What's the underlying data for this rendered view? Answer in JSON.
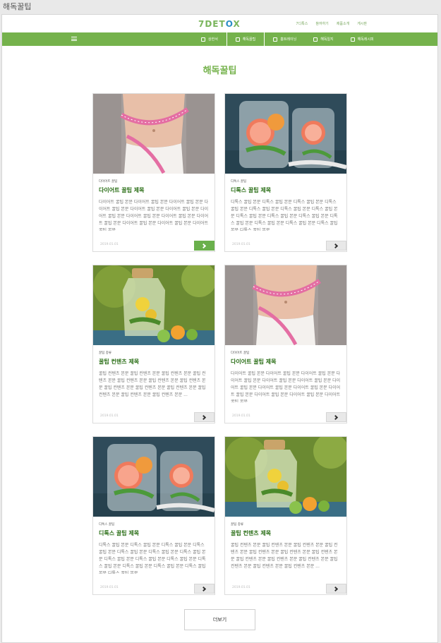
{
  "window": {
    "title": "해독꿀팁"
  },
  "header": {
    "logo": "7DETOX",
    "top_links": [
      "7디톡스",
      "참여하기",
      "제품소개",
      "게시판"
    ]
  },
  "nav": {
    "items": [
      "상한서",
      "해독꿀팁",
      "홈트레이닝",
      "해독일지",
      "해독레시피"
    ]
  },
  "section": {
    "title": "해독꿀팁"
  },
  "cards": [
    {
      "category": "다이어트 꿀팁",
      "title": "다이어트 꿀팁 제목",
      "body": "다이어트 꿀팁 본문 다이어트 꿀팁 본문 다이어트 꿀팁 본문 다이어트 꿀팁 본문 다이어트 꿀팁 본문 다이어트 꿀팁 본문 다이어트 꿀팁 본문 다이어트 꿀팁 본문 다이어트 꿀팁 본문 다이어트 꿀팁 본문 다이어트 꿀팁 본문 다이어트 꿀팁 본문 다이어트 꿀팁 본문 ...",
      "date": "2019.01.01",
      "image": "belly"
    },
    {
      "category": "디톡스 꿀팁",
      "title": "디톡스 꿀팁 제목",
      "body": "디톡스 꿀팁 본문 디톡스 꿀팁 본문 디톡스 꿀팁 본문 디톡스 꿀팁 본문 디톡스 꿀팁 본문 디톡스 꿀팁 본문 디톡스 꿀팁 본문 디톡스 꿀팁 본문 디톡스 꿀팁 본문 디톡스 꿀팁 본문 디톡스 꿀팁 본문 디톡스 꿀팁 본문 디톡스 꿀팁 본문 디톡스 꿀팁 본문 디톡스 꿀팁 본문 ...",
      "date": "2019.01.01",
      "image": "grapefruit"
    },
    {
      "category": "꿀팁 종류",
      "title": "꿀팁 컨텐츠 제목",
      "body": "꿀팁 컨텐츠 본문 꿀팁 컨텐츠 본문 꿀팁 컨텐츠 본문 꿀팁 컨텐츠 본문 꿀팁 컨텐츠 본문 꿀팁 컨텐츠 본문 꿀팁 컨텐츠 본문 꿀팁 컨텐츠 본문 꿀팁 컨텐츠 본문 꿀팁 컨텐츠 본문 꿀팁 컨텐츠 본문 꿀팁 컨텐츠 본문 꿀팁 컨텐츠 본문 ...",
      "date": "2019.01.01",
      "image": "lemon"
    },
    {
      "category": "다이어트 꿀팁",
      "title": "다이어트 꿀팁 제목",
      "body": "다이어트 꿀팁 본문 다이어트 꿀팁 본문 다이어트 꿀팁 본문 다이어트 꿀팁 본문 다이어트 꿀팁 본문 다이어트 꿀팁 본문 다이어트 꿀팁 본문 다이어트 꿀팁 본문 다이어트 꿀팁 본문 다이어트 꿀팁 본문 다이어트 꿀팁 본문 다이어트 꿀팁 본문 다이어트 꿀팁 본문 ...",
      "date": "2019.01.01",
      "image": "belly"
    },
    {
      "category": "디톡스 꿀팁",
      "title": "디톡스 꿀팁 제목",
      "body": "디톡스 꿀팁 본문 디톡스 꿀팁 본문 디톡스 꿀팁 본문 디톡스 꿀팁 본문 디톡스 꿀팁 본문 디톡스 꿀팁 본문 디톡스 꿀팁 본문 디톡스 꿀팁 본문 디톡스 꿀팁 본문 디톡스 꿀팁 본문 디톡스 꿀팁 본문 디톡스 꿀팁 본문 디톡스 꿀팁 본문 디톡스 꿀팁 본문 디톡스 꿀팁 본문 ...",
      "date": "2019.01.01",
      "image": "grapefruit"
    },
    {
      "category": "꿀팁 종류",
      "title": "꿀팁 컨텐츠 제목",
      "body": "꿀팁 컨텐츠 본문 꿀팁 컨텐츠 본문 꿀팁 컨텐츠 본문 꿀팁 컨텐츠 본문 꿀팁 컨텐츠 본문 꿀팁 컨텐츠 본문 꿀팁 컨텐츠 본문 꿀팁 컨텐츠 본문 꿀팁 컨텐츠 본문 꿀팁 컨텐츠 본문 꿀팁 컨텐츠 본문 꿀팁 컨텐츠 본문 꿀팁 컨텐츠 본문 ...",
      "date": "2019.01.01",
      "image": "lemon"
    }
  ],
  "load_more": "더보기",
  "colors": {
    "brand_green": "#75b24c",
    "title_green": "#2a6e16",
    "logo_blue": "#2d8fc6"
  },
  "icons": {
    "menu": "hamburger-icon",
    "more": "chevron-right-icon"
  }
}
